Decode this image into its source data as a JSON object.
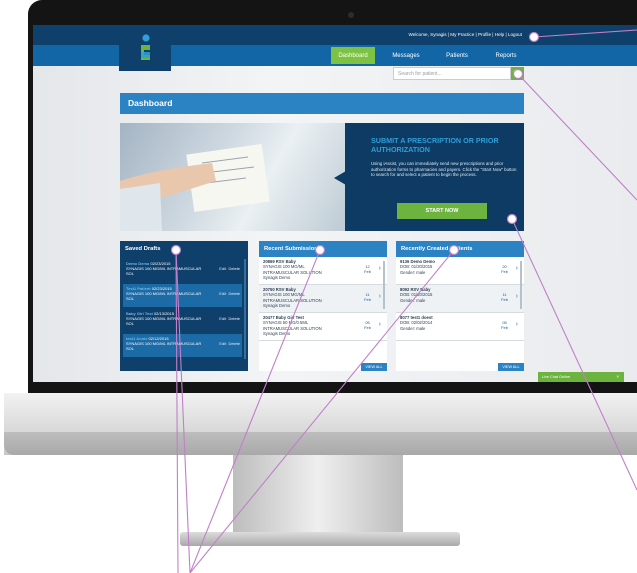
{
  "header": {
    "user_links": "Welcome, Synagis | My Practice | Profile | Help | Logout"
  },
  "nav": {
    "tabs": [
      "Dashboard",
      "Messages",
      "Patients",
      "Reports"
    ],
    "active_tab": "Dashboard"
  },
  "search": {
    "placeholder": "Search for patient..."
  },
  "dashboard": {
    "title": "Dashboard"
  },
  "hero": {
    "title": "SUBMIT A PRESCRIPTION OR PRIOR AUTHORIZATION",
    "text": "Using iAssist, you can immediately send new prescriptions and prior authorization forms to pharmacies and payers. Click the \"Start Now\" button to search for and select a patient to begin the process.",
    "button": "START NOW"
  },
  "saved_drafts": {
    "title": "Saved Drafts",
    "items": [
      {
        "name": "Demo Demo",
        "date": "02/23/2015",
        "drug": "SYNAGIS 100 MG/ML INTRAMUSCULAR SOL"
      },
      {
        "name": "Test1 Patient",
        "date": "02/23/2015",
        "drug": "SYNAGIS 100 MG/ML INTRAMUSCULAR SOL"
      },
      {
        "name": "Baby Girl Test",
        "date": "02/13/2015",
        "drug": "SYNAGIS 100 MG/ML INTRAMUSCULAR SOL"
      },
      {
        "name": "test1 Annie",
        "date": "02/12/2015",
        "drug": "SYNAGIS 100 MG/ML INTRAMUSCULAR SOL"
      }
    ],
    "edit_label": "Edit",
    "delete_label": "Delete"
  },
  "recent_submissions": {
    "title": "Recent Submissions",
    "items": [
      {
        "line1": "20869  RSV Baby",
        "line2": "SYNAGIS 100 MG/ML",
        "line3": "INTRAMUSCULAR SOLUTION",
        "line4": "Synagis Demo",
        "day": "12",
        "month": "Feb"
      },
      {
        "line1": "20750  RSV Baby",
        "line2": "SYNAGIS 100 MG/ML",
        "line3": "INTRAMUSCULAR SOLUTION",
        "line4": "Synagis Demo",
        "day": "11",
        "month": "Feb"
      },
      {
        "line1": "20477  Baby Girl Test",
        "line2": "SYNAGIS 50 MG/0.5ML",
        "line3": "INTRAMUSCULAR SOLUTION",
        "line4": "Synagis Demo",
        "day": "05",
        "month": "Feb"
      }
    ],
    "view_all": "VIEW ALL"
  },
  "recent_patients": {
    "title": "Recently Created Patients",
    "items": [
      {
        "line1": "9136  Demo Demo",
        "line2": "DOB: 01/20/2015",
        "line3": "Gender: male",
        "day": "20",
        "month": "Feb"
      },
      {
        "line1": "8092  RSV Baby",
        "line2": "DOB: 01/20/2015",
        "line3": "Gender: male",
        "day": "11",
        "month": "Feb"
      },
      {
        "line1": "8077  test1 doest",
        "line2": "DOB: 02/02/2014",
        "line3": "Gender: male",
        "day": "05",
        "month": "Feb"
      }
    ],
    "view_all": "VIEW ALL"
  },
  "chat": {
    "label": "Live Chat Online"
  },
  "colors": {
    "navy": "#0f3f6b",
    "blue": "#2b83c4",
    "green": "#6cb33f",
    "callout": "#c080c8"
  },
  "icons": [
    "logo-icon",
    "search-icon",
    "chevron-right-icon",
    "close-icon"
  ]
}
